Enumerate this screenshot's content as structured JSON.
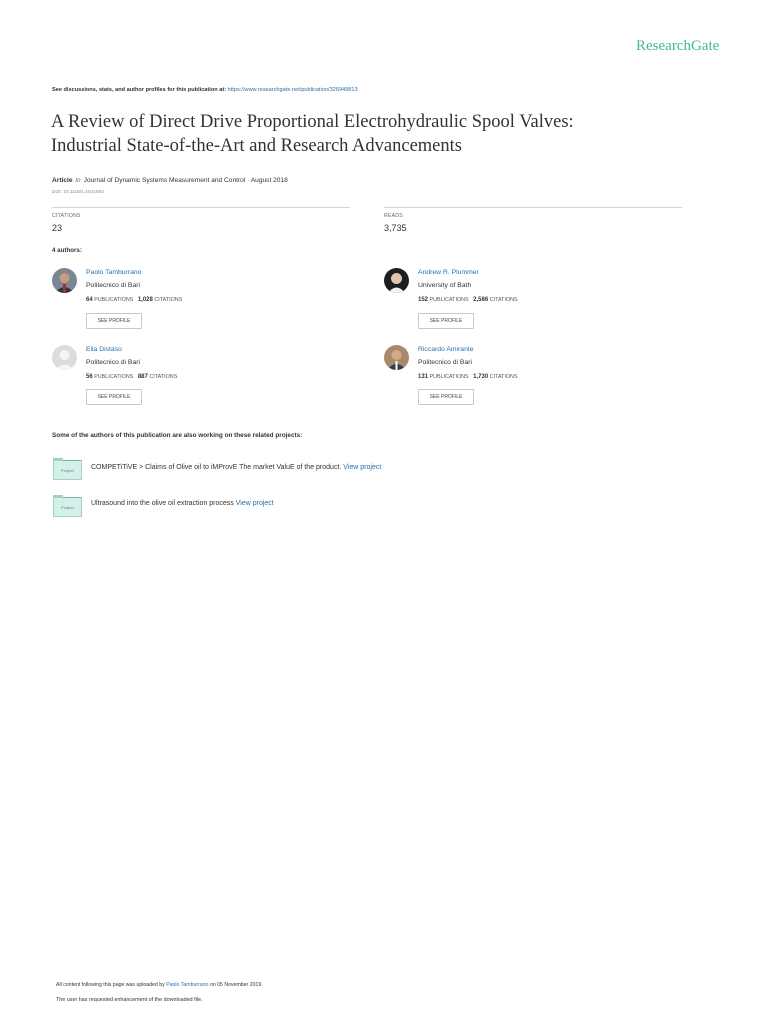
{
  "brand": "ResearchGate",
  "header": {
    "discussions_text": "See discussions, stats, and author profiles for this publication at:",
    "publication_url": "https://www.researchgate.net/publication/326949813"
  },
  "paper": {
    "title_line1": "A Review of Direct Drive Proportional Electrohydraulic Spool Valves:",
    "title_line2": "Industrial State-of-the-Art and Research Advancements",
    "type": "Article",
    "in_word": "in",
    "venue": "Journal of Dynamic Systems Measurement and Control · August 2018",
    "doi": "DOI: 10.1115/1.4041063"
  },
  "stats": {
    "citations_label": "CITATIONS",
    "citations_value": "23",
    "reads_label": "READS",
    "reads_value": "3,735"
  },
  "authors_heading": "4 authors:",
  "authors": [
    {
      "name": "Paolo Tamburrano",
      "institution": "Politecnico di Bari",
      "publications": "64",
      "publications_label": "PUBLICATIONS",
      "citations": "1,028",
      "citations_label": "CITATIONS",
      "button": "SEE PROFILE"
    },
    {
      "name": "Andrew R. Plummer",
      "institution": "University of Bath",
      "publications": "152",
      "publications_label": "PUBLICATIONS",
      "citations": "2,586",
      "citations_label": "CITATIONS",
      "button": "SEE PROFILE"
    },
    {
      "name": "Elia Distaso",
      "institution": "Politecnico di Bari",
      "publications": "56",
      "publications_label": "PUBLICATIONS",
      "citations": "887",
      "citations_label": "CITATIONS",
      "button": "SEE PROFILE"
    },
    {
      "name": "Riccardo Amirante",
      "institution": "Politecnico di Bari",
      "publications": "131",
      "publications_label": "PUBLICATIONS",
      "citations": "1,730",
      "citations_label": "CITATIONS",
      "button": "SEE PROFILE"
    }
  ],
  "projects_heading": "Some of the authors of this publication are also working on these related projects:",
  "projects": [
    {
      "icon_label": "Project",
      "text": "COMPETiTiVE > Claims of Olive oil to iMProvE The market ValuE of the product.",
      "link": "View project"
    },
    {
      "icon_label": "Project",
      "text": "Ultrasound into the olive oil extraction process",
      "link": "View project"
    }
  ],
  "footer": {
    "uploaded_prefix": "All content following this page was uploaded by",
    "uploader": "Paolo Tamburrano",
    "uploaded_suffix": "on 05 November 2019.",
    "request_note": "The user has requested enhancement of the downloaded file."
  },
  "colors": {
    "brand": "#40ba9b",
    "link": "#2b6fa8",
    "project_icon": "#d5efe9"
  }
}
